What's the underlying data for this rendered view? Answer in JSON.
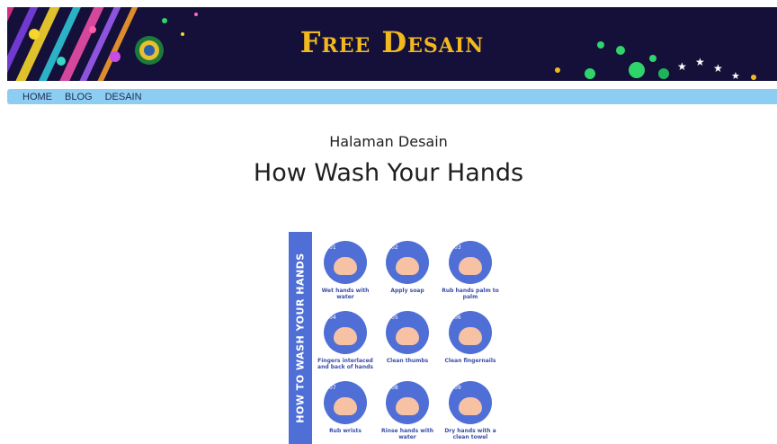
{
  "header": {
    "title": "Free Desain"
  },
  "nav": {
    "items": [
      {
        "label": "HOME"
      },
      {
        "label": "BLOG"
      },
      {
        "label": "DESAIN"
      }
    ]
  },
  "page": {
    "subtitle": "Halaman Desain",
    "title": "How Wash Your Hands"
  },
  "infographic": {
    "heading": "HOW TO WASH YOUR HANDS",
    "steps": [
      {
        "num": "01",
        "label": "Wet hands with water"
      },
      {
        "num": "02",
        "label": "Apply soap"
      },
      {
        "num": "03",
        "label": "Rub hands palm to palm"
      },
      {
        "num": "04",
        "label": "Fingers interlaced and back of hands"
      },
      {
        "num": "05",
        "label": "Clean thumbs"
      },
      {
        "num": "06",
        "label": "Clean fingernails"
      },
      {
        "num": "07",
        "label": "Rub wrists"
      },
      {
        "num": "08",
        "label": "Rinse hands with water"
      },
      {
        "num": "09",
        "label": "Dry hands with a clean towel"
      }
    ]
  },
  "colors": {
    "banner_bg": "#14103a",
    "banner_title": "#f2b91e",
    "nav_bg": "#8ecdf2",
    "infographic_blue": "#4f6fd6"
  }
}
